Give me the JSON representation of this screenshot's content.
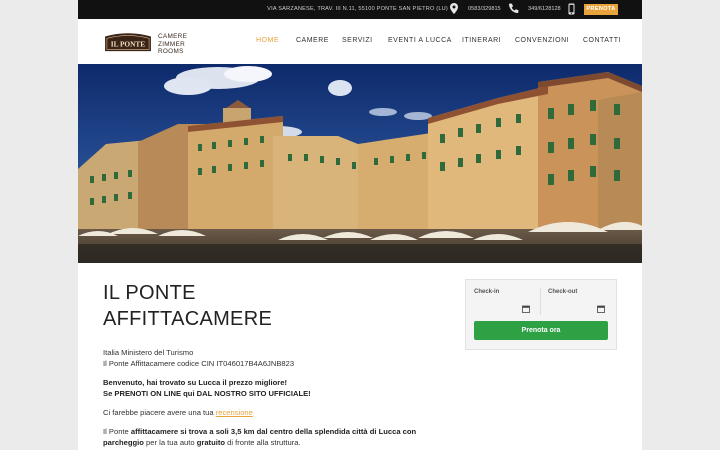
{
  "topbar": {
    "address": "VIA SARZANESE, TRAV. III N.11, 55100 PONTE SAN PIETRO (LU)",
    "phone1": "0583/329815",
    "phone2": "349/6128128",
    "book_button": "PRENOTA"
  },
  "logo": {
    "sign_text": "IL PONTE",
    "line1": "CAMERE",
    "line2": "ZIMMER",
    "line3": "ROOMS"
  },
  "nav": [
    {
      "label": "HOME",
      "active": true
    },
    {
      "label": "CAMERE"
    },
    {
      "label": "SERVIZI"
    },
    {
      "label": "EVENTI A LUCCA"
    },
    {
      "label": "ITINERARI"
    },
    {
      "label": "CONVENZIONI"
    },
    {
      "label": "CONTATTI"
    }
  ],
  "main": {
    "title_line1": "IL PONTE",
    "title_line2": "AFFITTACAMERE",
    "ministry": "Italia Ministero del Turismo",
    "cin": "Il Ponte Affittacamere codice CIN IT046017B4A6JNB823",
    "welcome1": "Benvenuto, hai trovato su Lucca il prezzo migliore!",
    "welcome2": "Se PRENOTI ON LINE qui DAL NOSTRO SITO UFFICIALE!",
    "review_pre": "Ci farebbe piacere avere una tua ",
    "review_link": "recensione",
    "p1_a": "Il Ponte ",
    "p1_b": "affittacamere si trova a soli 3,5 km dal centro della splendida città di Lucca con",
    "p2_a": "parcheggio",
    "p2_b": " per la tua auto ",
    "p2_c": "gratuito",
    "p2_d": " di fronte alla struttura."
  },
  "booking": {
    "checkin_label": "Check-in",
    "checkout_label": "Check-out",
    "submit": "Prenota ora"
  },
  "colors": {
    "accent": "#e8a33d",
    "green": "#2fa145",
    "topbar": "#111111"
  }
}
